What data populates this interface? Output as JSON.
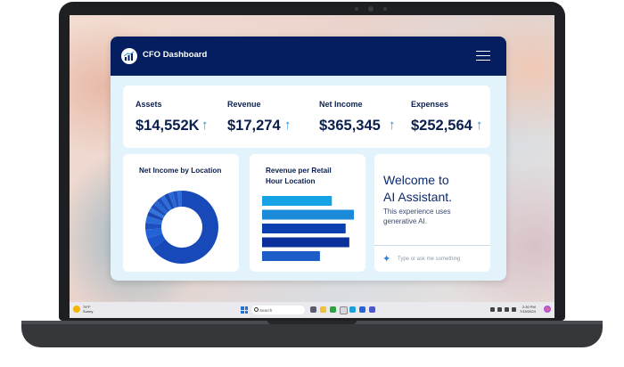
{
  "dashboard": {
    "title": "CFO Dashboard",
    "menu_icon": "hamburger-menu-icon",
    "kpis": [
      {
        "label": "Assets",
        "value": "$14,552K",
        "arrow": "↑"
      },
      {
        "label": "Revenue",
        "value": "$17,274",
        "arrow": "↑"
      },
      {
        "label": "Net Income",
        "value": "$365,345",
        "arrow": "↑"
      },
      {
        "label": "Expenses",
        "value": "$252,564",
        "arrow": "↑"
      }
    ],
    "net_income_panel": {
      "title": "Net Income by Location"
    },
    "revenue_panel": {
      "title_line1": "Revenue per Retail",
      "title_line2": "Hour Location"
    },
    "ai_panel": {
      "title_line1": "Welcome to",
      "title_line2": "AI Assistant.",
      "subtitle_line1": "This experience uses",
      "subtitle_line2": "generative AI.",
      "input_placeholder": "Type or ask me something"
    }
  },
  "chart_data": [
    {
      "type": "pie",
      "title": "Net Income by Location",
      "style": "donut",
      "slices": [
        0.65,
        0.05,
        0.04,
        0.03,
        0.03,
        0.02,
        0.02,
        0.02,
        0.02,
        0.02,
        0.02,
        0.02,
        0.02,
        0.02,
        0.02
      ],
      "colors": [
        "#1749b8",
        "#1b55c9",
        "#2262d6",
        "#1d4fbe",
        "#2a6ad8",
        "#1a46ad",
        "#2f73dd",
        "#1c4db8",
        "#2566d2",
        "#1e50bf",
        "#2d6fd9",
        "#1a48b0",
        "#2868d6",
        "#1f53c2",
        "#2b6cd8"
      ]
    },
    {
      "type": "bar",
      "orientation": "horizontal",
      "title": "Revenue per Retail Hour Location",
      "values": [
        0.76,
        1.0,
        0.91,
        0.95,
        0.63
      ],
      "colors": [
        "#16a3e6",
        "#1b8ad8",
        "#0b3fb0",
        "#0a2e9a",
        "#1d5dc8"
      ]
    }
  ],
  "taskbar": {
    "weather_text_line1": "79°F",
    "weather_text_line2": "Sunny",
    "search_placeholder": "Search",
    "time": "2:30 PM",
    "date": "7/15/2024"
  }
}
